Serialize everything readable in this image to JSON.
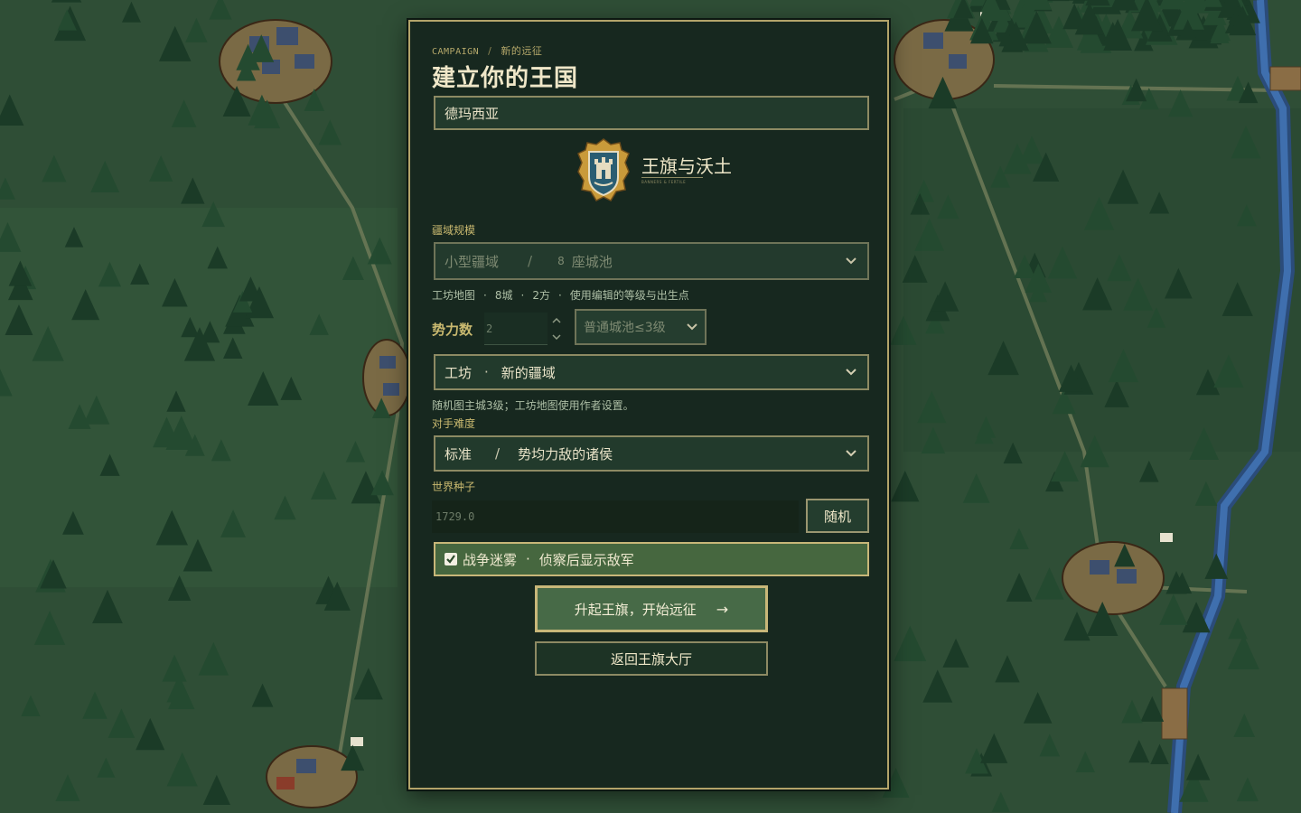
{
  "breadcrumb": {
    "root": "CAMPAIGN",
    "separator": "/",
    "current": "新的远征"
  },
  "page_title": "建立你的王国",
  "kingdom_name": {
    "value": "德玛西亚"
  },
  "brand": {
    "name": "王旗与沃土",
    "tagline": "BANNERS & FERTILE",
    "emblem_icon": "castle-crest-icon"
  },
  "territory": {
    "label": "疆域规模",
    "selected": {
      "size": "小型疆域",
      "separator": "/",
      "count": "8",
      "unit": "座城池"
    },
    "hint": {
      "part1": "工坊地图",
      "part2": "8城",
      "part3": "2方",
      "part4": "使用编辑的等级与出生点",
      "dot": "·"
    }
  },
  "factions": {
    "label": "势力数",
    "value": "2",
    "city_level": "普通城池≤3级"
  },
  "map_source": {
    "selected": {
      "source": "工坊",
      "dot": "·",
      "map": "新的疆域"
    },
    "hint": "随机图主城3级；工坊地图使用作者设置。"
  },
  "difficulty": {
    "label": "对手难度",
    "selected": {
      "level": "标准",
      "separator": "/",
      "desc": "势均力敌的诸侯"
    }
  },
  "seed": {
    "label": "世界种子",
    "value": "1729.0",
    "random_button": "随机"
  },
  "fog_of_war": {
    "checked": true,
    "label": "战争迷雾",
    "dot": "·",
    "desc": "侦察后显示敌军"
  },
  "buttons": {
    "start": "升起王旗，开始远征",
    "start_arrow": "→",
    "back": "返回王旗大厅"
  },
  "colors": {
    "panel": "#17281f",
    "gold": "#c8b779",
    "accent_green": "#46673f",
    "text": "#efe7c8"
  }
}
